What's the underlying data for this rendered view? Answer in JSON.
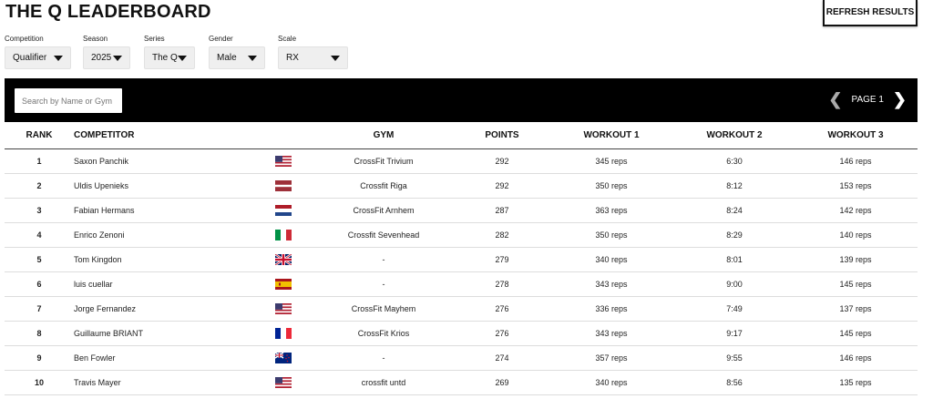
{
  "header": {
    "title": "THE Q LEADERBOARD",
    "refresh_label": "REFRESH RESULTS"
  },
  "filters": [
    {
      "label": "Competition",
      "value": "Qualifier"
    },
    {
      "label": "Season",
      "value": "2025"
    },
    {
      "label": "Series",
      "value": "The Q"
    },
    {
      "label": "Gender",
      "value": "Male"
    },
    {
      "label": "Scale",
      "value": "RX"
    }
  ],
  "search": {
    "placeholder": "Search by Name or Gym"
  },
  "pager": {
    "label": "PAGE 1",
    "prev_icon": "chevron-left-icon",
    "next_icon": "chevron-right-icon"
  },
  "columns": {
    "rank": "RANK",
    "competitor": "COMPETITOR",
    "gym": "GYM",
    "points": "POINTS",
    "w1": "WORKOUT 1",
    "w2": "WORKOUT 2",
    "w3": "WORKOUT 3"
  },
  "rows": [
    {
      "rank": "1",
      "name": "Saxon Panchik",
      "flag": "us",
      "gym": "CrossFit Trivium",
      "points": "292",
      "w1": "345 reps",
      "w2": "6:30",
      "w3": "146 reps"
    },
    {
      "rank": "2",
      "name": "Uldis Upenieks",
      "flag": "lv",
      "gym": "Crossfit Riga",
      "points": "292",
      "w1": "350 reps",
      "w2": "8:12",
      "w3": "153 reps"
    },
    {
      "rank": "3",
      "name": "Fabian Hermans",
      "flag": "nl",
      "gym": "CrossFit Arnhem",
      "points": "287",
      "w1": "363 reps",
      "w2": "8:24",
      "w3": "142 reps"
    },
    {
      "rank": "4",
      "name": "Enrico Zenoni",
      "flag": "it",
      "gym": "Crossfit Sevenhead",
      "points": "282",
      "w1": "350 reps",
      "w2": "8:29",
      "w3": "140 reps"
    },
    {
      "rank": "5",
      "name": "Tom Kingdon",
      "flag": "gb",
      "gym": "-",
      "points": "279",
      "w1": "340 reps",
      "w2": "8:01",
      "w3": "139 reps"
    },
    {
      "rank": "6",
      "name": "luis cuellar",
      "flag": "es",
      "gym": "-",
      "points": "278",
      "w1": "343 reps",
      "w2": "9:00",
      "w3": "145 reps"
    },
    {
      "rank": "7",
      "name": "Jorge Fernandez",
      "flag": "us",
      "gym": "CrossFit Mayhem",
      "points": "276",
      "w1": "336 reps",
      "w2": "7:49",
      "w3": "137 reps"
    },
    {
      "rank": "8",
      "name": "Guillaume BRIANT",
      "flag": "fr",
      "gym": "CrossFit Krios",
      "points": "276",
      "w1": "343 reps",
      "w2": "9:17",
      "w3": "145 reps"
    },
    {
      "rank": "9",
      "name": "Ben Fowler",
      "flag": "nz",
      "gym": "-",
      "points": "274",
      "w1": "357 reps",
      "w2": "9:55",
      "w3": "146 reps"
    },
    {
      "rank": "10",
      "name": "Travis Mayer",
      "flag": "us",
      "gym": "crossfit untd",
      "points": "269",
      "w1": "340 reps",
      "w2": "8:56",
      "w3": "135 reps"
    }
  ]
}
